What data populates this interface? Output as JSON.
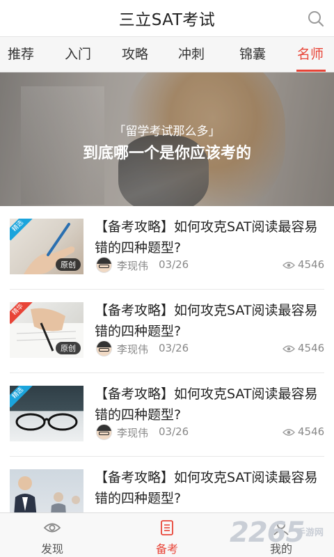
{
  "header": {
    "title": "三立SAT考试"
  },
  "tabs": [
    {
      "label": "推荐"
    },
    {
      "label": "入门"
    },
    {
      "label": "攻略"
    },
    {
      "label": "冲刺"
    },
    {
      "label": "锦囊"
    },
    {
      "label": "名师"
    }
  ],
  "active_tab": "名师",
  "banner": {
    "subtitle": "「留学考试那么多」",
    "headline": "到底哪一个是你应该考的"
  },
  "articles": [
    {
      "ribbon": "精选",
      "badge": "原创",
      "title": "【备考攻略】如何攻克SAT阅读最容易错的四种题型?",
      "author": "李现伟",
      "date": "03/26",
      "views": "4546"
    },
    {
      "ribbon": "精华",
      "badge": "原创",
      "title": "【备考攻略】如何攻克SAT阅读最容易错的四种题型?",
      "author": "李现伟",
      "date": "03/26",
      "views": "4546"
    },
    {
      "ribbon": "精选",
      "badge": "",
      "title": "【备考攻略】如何攻克SAT阅读最容易错的四种题型?",
      "author": "李现伟",
      "date": "03/26",
      "views": "4546"
    },
    {
      "ribbon": "",
      "badge": "",
      "title": "【备考攻略】如何攻克SAT阅读最容易错的四种题型?",
      "author": "",
      "date": "",
      "views": ""
    }
  ],
  "bottom_nav": [
    {
      "label": "发现",
      "icon": "eye-icon"
    },
    {
      "label": "备考",
      "icon": "checklist-icon"
    },
    {
      "label": "我的",
      "icon": "user-icon"
    }
  ],
  "active_nav": "备考",
  "watermark": {
    "big": "2265",
    "small": "手游网"
  },
  "colors": {
    "accent": "#e84437",
    "ribbon_blue": "#1ba4dc"
  }
}
